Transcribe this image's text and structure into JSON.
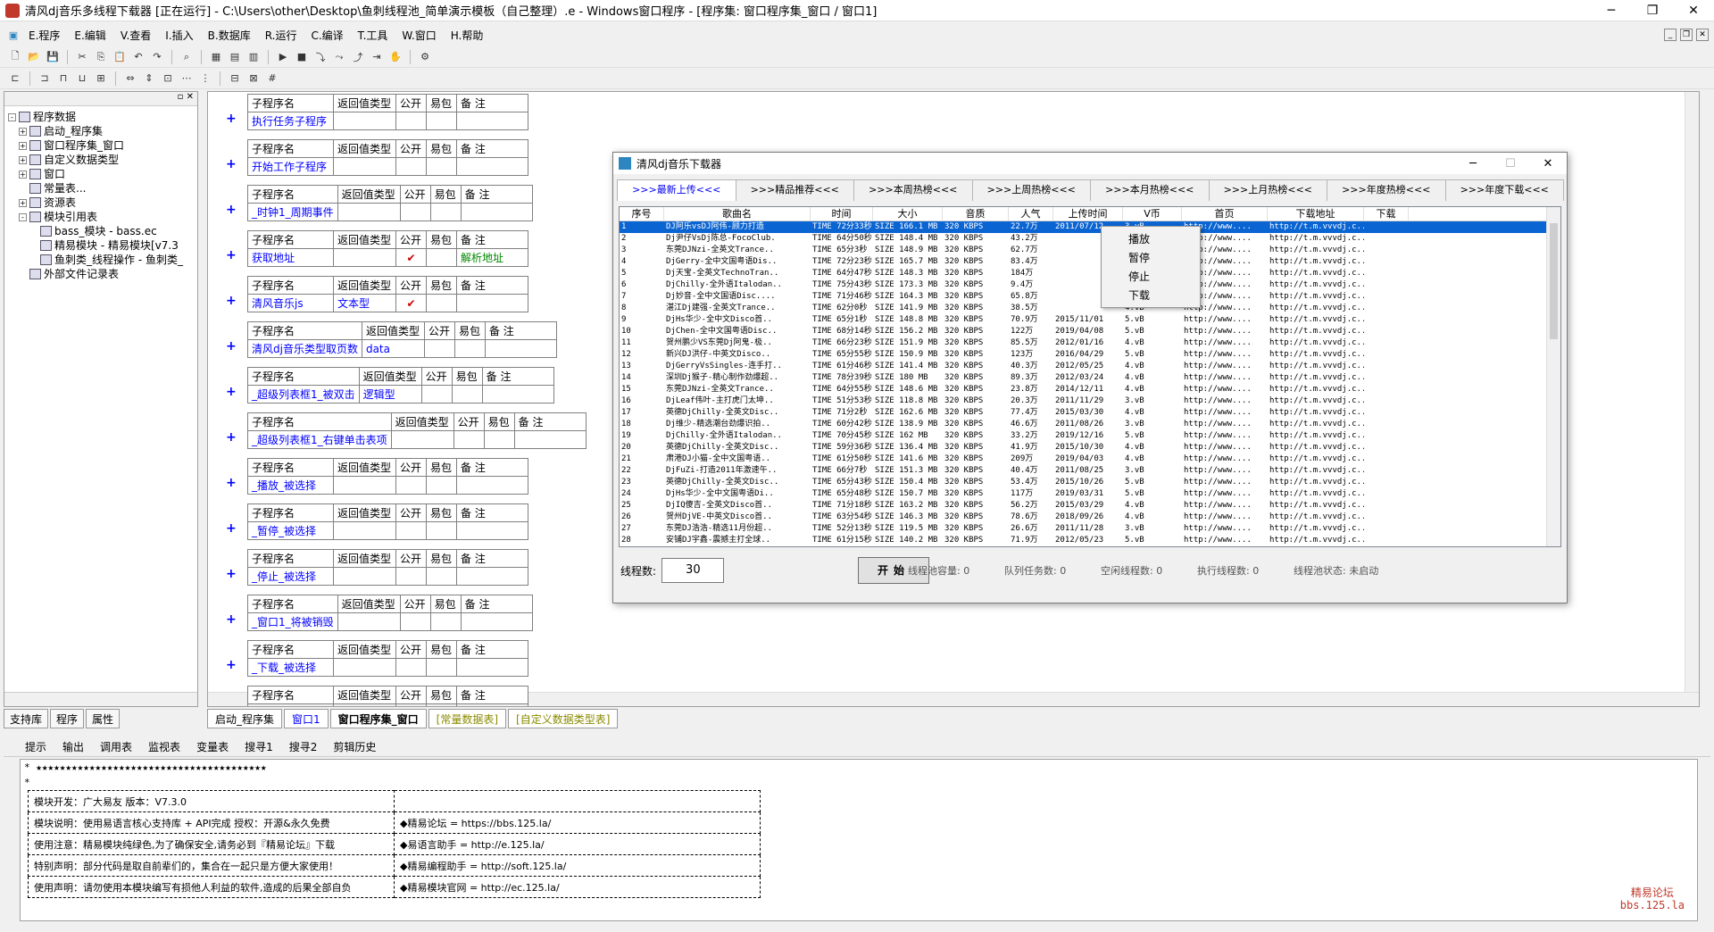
{
  "window": {
    "title": "清风dj音乐多线程下载器 [正在运行] - C:\\Users\\other\\Desktop\\鱼刺线程池_简单演示模板（自己整理）.e - Windows窗口程序 - [程序集: 窗口程序集_窗口 / 窗口1]",
    "min": "─",
    "max": "❐",
    "close": "✕"
  },
  "menu": [
    "E.程序",
    "E.编辑",
    "V.查看",
    "I.插入",
    "B.数据库",
    "R.运行",
    "C.编译",
    "T.工具",
    "W.窗口",
    "H.帮助"
  ],
  "tree": {
    "root": "程序数据",
    "nodes": [
      {
        "label": "启动_程序集",
        "indent": 1,
        "exp": "+"
      },
      {
        "label": "窗口程序集_窗口",
        "indent": 1,
        "exp": "+"
      },
      {
        "label": "自定义数据类型",
        "indent": 1,
        "exp": "+"
      },
      {
        "label": "窗口",
        "indent": 1,
        "exp": "+"
      },
      {
        "label": "常量表...",
        "indent": 1,
        "exp": ""
      },
      {
        "label": "资源表",
        "indent": 1,
        "exp": "+"
      },
      {
        "label": "模块引用表",
        "indent": 1,
        "exp": "-"
      },
      {
        "label": "bass_模块 - bass.ec",
        "indent": 2,
        "exp": ""
      },
      {
        "label": "精易模块 - 精易模块[v7.3",
        "indent": 2,
        "exp": ""
      },
      {
        "label": "鱼刺类_线程操作 - 鱼刺类_",
        "indent": 2,
        "exp": ""
      },
      {
        "label": "外部文件记录表",
        "indent": 1,
        "exp": ""
      }
    ]
  },
  "left_tabs": [
    "支持库",
    "程序",
    "属性"
  ],
  "sub_headers": {
    "name": "子程序名",
    "ret": "返回值类型",
    "public": "公开",
    "easy": "易包",
    "note": "备 注"
  },
  "subs": [
    {
      "name": "执行任务子程序",
      "ret": "",
      "mark": ""
    },
    {
      "name": "开始工作子程序",
      "ret": "",
      "mark": ""
    },
    {
      "name": "_时钟1_周期事件",
      "ret": "",
      "mark": ""
    },
    {
      "name": "获取地址",
      "ret": "",
      "mark": "✔",
      "note": "解析地址"
    },
    {
      "name": "清风音乐js",
      "ret": "文本型",
      "mark": "✔"
    },
    {
      "name": "清风dj音乐类型取页数",
      "ret": "data",
      "mark": ""
    },
    {
      "name": "_超级列表框1_被双击",
      "ret": "逻辑型",
      "mark": ""
    },
    {
      "name": "_超级列表框1_右键单击表项",
      "ret": "",
      "mark": ""
    },
    {
      "name": "_播放_被选择",
      "ret": "",
      "mark": ""
    },
    {
      "name": "_暂停_被选择",
      "ret": "",
      "mark": ""
    },
    {
      "name": "_停止_被选择",
      "ret": "",
      "mark": ""
    },
    {
      "name": "_窗口1_将被销毁",
      "ret": "",
      "mark": ""
    },
    {
      "name": "_下载_被选择",
      "ret": "",
      "mark": ""
    },
    {
      "name": "",
      "ret": "",
      "mark": ""
    }
  ],
  "doc_tabs": [
    "启动_程序集",
    "窗口1",
    "窗口程序集_窗口",
    "[常量数据表]",
    "[自定义数据类型表]"
  ],
  "bottom_tabs": [
    "提示",
    "输出",
    "调用表",
    "监视表",
    "变量表",
    "搜寻1",
    "搜寻2",
    "剪辑历史"
  ],
  "output": {
    "stars": "* ★★★★★★★★★★★★★★★★★★★★★★★★★★★★★★★★★★★★★★★",
    "star2": "*",
    "rows": [
      [
        "模块开发：广大易友    版本：V7.3.0",
        ""
      ],
      [
        "模块说明：使用易语言核心支持库 + API完成      授权：开源&永久免费",
        "◆精易论坛        = https://bbs.125.la/"
      ],
      [
        "使用注意：精易模块纯绿色,为了确保安全,请务必到『精易论坛』下载",
        "◆易语言助手      = http://e.125.la/"
      ],
      [
        "特别声明：部分代码是取自前辈们的，集合在一起只是方便大家使用！",
        "◆精易编程助手    = http://soft.125.la/"
      ],
      [
        "使用声明：请勿使用本模块编写有损他人利益的软件,造成的后果全部自负",
        "◆精易模块官网    = http://ec.125.la/"
      ]
    ],
    "watermark1": "精易论坛",
    "watermark2": "bbs.125.la"
  },
  "dialog": {
    "title": "清风dj音乐下载器",
    "min": "─",
    "max": "☐",
    "close": "✕",
    "tabs": [
      ">>>最新上传<<<",
      ">>>精品推荐<<<",
      ">>>本周热榜<<<",
      ">>>上周热榜<<<",
      ">>>本月热榜<<<",
      ">>>上月热榜<<<",
      ">>>年度热榜<<<",
      ">>>年度下载<<<"
    ],
    "columns": [
      "序号",
      "歌曲名",
      "时间",
      "大小",
      "音质",
      "人气",
      "上传时间",
      "V币",
      "首页",
      "下载地址",
      "下载"
    ],
    "context_menu": [
      "播放",
      "暂停",
      "停止",
      "下载"
    ],
    "threads_label": "线程数:",
    "threads_value": "30",
    "start_button": "开始",
    "stats": [
      "线程池容量: 0",
      "队列任务数: 0",
      "空闲线程数: 0",
      "执行线程数: 0",
      "线程池状态: 未启动"
    ],
    "rows": [
      [
        "1",
        "DJ阿乐vsDJ阿伟-顾力打造",
        "TIME 72分33秒",
        "SIZE 166.1 MB",
        "320 KBPS",
        "22.7万",
        "2011/07/12",
        "3.vB",
        "http://www....",
        "http://t.m.vvvdj.c..."
      ],
      [
        "2",
        "Dj尹仔VsDj陈总-FocoClub.",
        "TIME 64分50秒",
        "SIZE 148.4 MB",
        "320 KBPS",
        "43.2万",
        "",
        "5.vB",
        "http://www....",
        "http://t.m.vvvdj.c..."
      ],
      [
        "3",
        "东莞DJNzi-全英文Trance..",
        "TIME 65分3秒",
        "SIZE 148.9 MB",
        "320 KBPS",
        "62.7万",
        "",
        "4.vB",
        "http://www....",
        "http://t.m.vvvdj.c..."
      ],
      [
        "4",
        "DjGerry-全中文国粤语Dis..",
        "TIME 72分23秒",
        "SIZE 165.7 MB",
        "320 KBPS",
        "83.4万",
        "",
        "4.vB",
        "http://www....",
        "http://t.m.vvvdj.c..."
      ],
      [
        "5",
        "Dj天宝-全英文TechnoTran..",
        "TIME 64分47秒",
        "SIZE 148.3 MB",
        "320 KBPS",
        "184万",
        "",
        "5.vB",
        "http://www....",
        "http://t.m.vvvdj.c..."
      ],
      [
        "6",
        "DjChilly-全外语Italodan..",
        "TIME 75分43秒",
        "SIZE 173.3 MB",
        "320 KBPS",
        "9.4万",
        "",
        "5.vB",
        "http://www....",
        "http://t.m.vvvdj.c..."
      ],
      [
        "7",
        "Dj妙音-全中文国语Disc....",
        "TIME 71分46秒",
        "SIZE 164.3 MB",
        "320 KBPS",
        "65.8万",
        "",
        "4.vB",
        "http://www....",
        "http://t.m.vvvdj.c..."
      ],
      [
        "8",
        "湛江Dj建强-全英文Trance..",
        "TIME 62分0秒",
        "SIZE 141.9 MB",
        "320 KBPS",
        "38.5万",
        "",
        "4.vB",
        "http://www....",
        "http://t.m.vvvdj.c..."
      ],
      [
        "9",
        "DjHs华少-全中文Disco首..",
        "TIME 65分1秒",
        "SIZE 148.8 MB",
        "320 KBPS",
        "70.9万",
        "2015/11/01",
        "5.vB",
        "http://www....",
        "http://t.m.vvvdj.c..."
      ],
      [
        "10",
        "DjChen-全中文国粤语Disc..",
        "TIME 68分14秒",
        "SIZE 156.2 MB",
        "320 KBPS",
        "122万",
        "2019/04/08",
        "5.vB",
        "http://www....",
        "http://t.m.vvvdj.c..."
      ],
      [
        "11",
        "贺州鹏少VS东莞Dj阿鬼-极..",
        "TIME 66分23秒",
        "SIZE 151.9 MB",
        "320 KBPS",
        "85.5万",
        "2012/01/16",
        "4.vB",
        "http://www....",
        "http://t.m.vvvdj.c..."
      ],
      [
        "12",
        "新兴DJ洪仔-中英文Disco..",
        "TIME 65分55秒",
        "SIZE 150.9 MB",
        "320 KBPS",
        "123万",
        "2016/04/29",
        "5.vB",
        "http://www....",
        "http://t.m.vvvdj.c..."
      ],
      [
        "13",
        "DjGerryVsSingles-连手打..",
        "TIME 61分46秒",
        "SIZE 141.4 MB",
        "320 KBPS",
        "40.3万",
        "2012/05/25",
        "4.vB",
        "http://www....",
        "http://t.m.vvvdj.c..."
      ],
      [
        "14",
        "深圳Dj猴子-精心制作劲爆超..",
        "TIME 78分39秒",
        "SIZE 180 MB",
        "320 KBPS",
        "89.3万",
        "2012/03/24",
        "4.vB",
        "http://www....",
        "http://t.m.vvvdj.c..."
      ],
      [
        "15",
        "东莞DJNzi-全英文Trance..",
        "TIME 64分55秒",
        "SIZE 148.6 MB",
        "320 KBPS",
        "23.8万",
        "2014/12/11",
        "4.vB",
        "http://www....",
        "http://t.m.vvvdj.c..."
      ],
      [
        "16",
        "DjLeaf伟叶-主打虎门太坤..",
        "TIME 51分53秒",
        "SIZE 118.8 MB",
        "320 KBPS",
        "20.3万",
        "2011/11/29",
        "3.vB",
        "http://www....",
        "http://t.m.vvvdj.c..."
      ],
      [
        "17",
        "英德DjChilly-全英文Disc..",
        "TIME 71分2秒",
        "SIZE 162.6 MB",
        "320 KBPS",
        "77.4万",
        "2015/03/30",
        "4.vB",
        "http://www....",
        "http://t.m.vvvdj.c..."
      ],
      [
        "18",
        "Dj维少-精选潮台劲爆识拍..",
        "TIME 60分42秒",
        "SIZE 138.9 MB",
        "320 KBPS",
        "46.6万",
        "2011/08/26",
        "3.vB",
        "http://www....",
        "http://t.m.vvvdj.c..."
      ],
      [
        "19",
        "DjChilly-全外语Italodan..",
        "TIME 70分45秒",
        "SIZE 162 MB",
        "320 KBPS",
        "33.2万",
        "2019/12/16",
        "5.vB",
        "http://www....",
        "http://t.m.vvvdj.c..."
      ],
      [
        "20",
        "英德DjChilly-全英文Disc..",
        "TIME 59分36秒",
        "SIZE 136.4 MB",
        "320 KBPS",
        "41.9万",
        "2015/10/30",
        "4.vB",
        "http://www....",
        "http://t.m.vvvdj.c..."
      ],
      [
        "21",
        "肃港DJ小猫-全中文国粤语..",
        "TIME 61分50秒",
        "SIZE 141.6 MB",
        "320 KBPS",
        "209万",
        "2019/04/03",
        "4.vB",
        "http://www....",
        "http://t.m.vvvdj.c..."
      ],
      [
        "22",
        "DjFuZi-打造2011年激速午..",
        "TIME 66分7秒",
        "SIZE 151.3 MB",
        "320 KBPS",
        "40.4万",
        "2011/08/25",
        "3.vB",
        "http://www....",
        "http://t.m.vvvdj.c..."
      ],
      [
        "23",
        "英德DjChilly-全英文Disc..",
        "TIME 65分43秒",
        "SIZE 150.4 MB",
        "320 KBPS",
        "53.4万",
        "2015/10/26",
        "5.vB",
        "http://www....",
        "http://t.m.vvvdj.c..."
      ],
      [
        "24",
        "DjHs华少-全中文国粤语Di..",
        "TIME 65分48秒",
        "SIZE 150.7 MB",
        "320 KBPS",
        "117万",
        "2019/03/31",
        "5.vB",
        "http://www....",
        "http://t.m.vvvdj.c..."
      ],
      [
        "25",
        "DjIQ傻吉-全英文Disco首..",
        "TIME 71分18秒",
        "SIZE 163.2 MB",
        "320 KBPS",
        "56.2万",
        "2015/03/29",
        "4.vB",
        "http://www....",
        "http://t.m.vvvdj.c..."
      ],
      [
        "26",
        "贺州DjVE-中英文Disco首..",
        "TIME 63分54秒",
        "SIZE 146.3 MB",
        "320 KBPS",
        "78.6万",
        "2018/09/26",
        "4.vB",
        "http://www....",
        "http://t.m.vvvdj.c..."
      ],
      [
        "27",
        "东莞DJ浩浩-精选11月份超..",
        "TIME 52分13秒",
        "SIZE 119.5 MB",
        "320 KBPS",
        "26.6万",
        "2011/11/28",
        "3.vB",
        "http://www....",
        "http://t.m.vvvdj.c..."
      ],
      [
        "28",
        "安铺DJ宇鑫-震撼主打全球..",
        "TIME 61分15秒",
        "SIZE 140.2 MB",
        "320 KBPS",
        "71.9万",
        "2012/05/23",
        "5.vB",
        "http://www....",
        "http://t.m.vvvdj.c..."
      ]
    ]
  }
}
